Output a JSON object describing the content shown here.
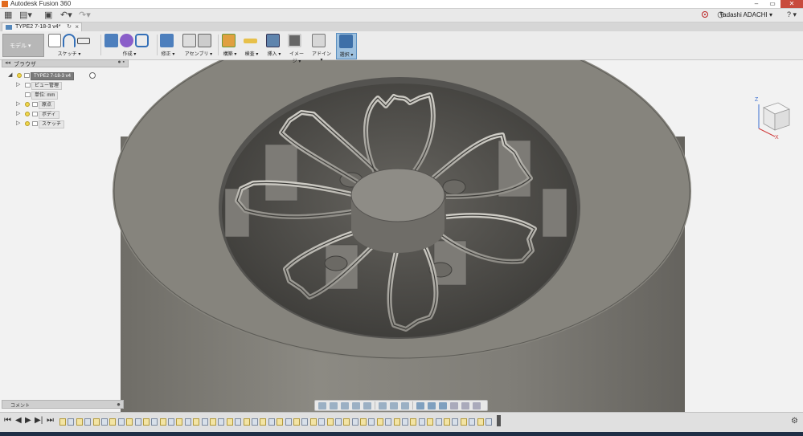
{
  "window": {
    "title": "Autodesk Fusion 360"
  },
  "appbar": {
    "user": "Tadashi ADACHI ▾",
    "help": "? ▾"
  },
  "document": {
    "tab_title": "TYPE2 7-18-3 v4*"
  },
  "ribbon": {
    "workspace": "モデル ▾",
    "groups": [
      {
        "label": "スケッチ ▾"
      },
      {
        "label": "作成 ▾"
      },
      {
        "label": "修正 ▾"
      },
      {
        "label": "アセンブリ ▾"
      },
      {
        "label": "構築 ▾"
      },
      {
        "label": "検査 ▾"
      },
      {
        "label": "挿入 ▾"
      },
      {
        "label": "イメージ ▾"
      },
      {
        "label": "アドイン ▾"
      },
      {
        "label": "選択 ▾"
      }
    ]
  },
  "browser": {
    "title": "ブラウザ",
    "root": "TYPE2 7-18-3 v4",
    "items": [
      "ビュー管理",
      "単位: mm",
      "原点",
      "ボディ",
      "スケッチ"
    ]
  },
  "comments": {
    "title": "コメント"
  },
  "viewcube": {
    "axes": [
      "Z",
      "X"
    ]
  },
  "colors": {
    "accent": "#5b8fc0",
    "model": "#86847d",
    "background": "#f2f2f2"
  }
}
